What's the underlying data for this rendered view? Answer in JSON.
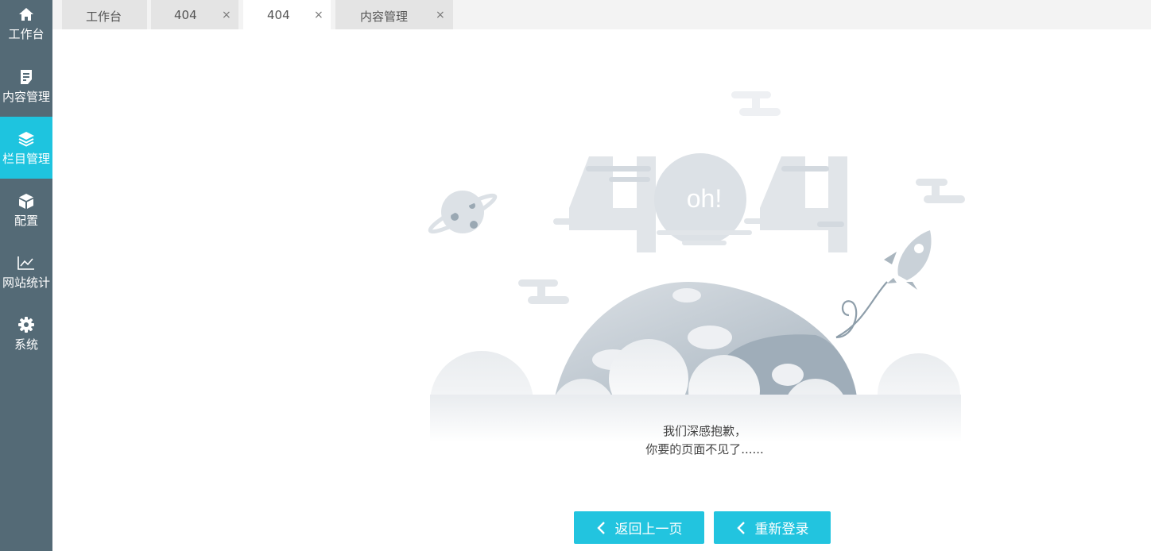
{
  "sidebar": {
    "items": [
      {
        "label": "工作台",
        "icon": "home-icon"
      },
      {
        "label": "内容管理",
        "icon": "document-edit-icon"
      },
      {
        "label": "栏目管理",
        "icon": "layers-icon",
        "active": true
      },
      {
        "label": "配置",
        "icon": "cube-icon"
      },
      {
        "label": "网站统计",
        "icon": "line-chart-icon"
      },
      {
        "label": "系统",
        "icon": "gear-icon"
      }
    ]
  },
  "tabs": [
    {
      "label": "工作台",
      "closable": false
    },
    {
      "label": "404",
      "closable": true,
      "close": "×"
    },
    {
      "label": "404",
      "closable": true,
      "active": true,
      "close": "×"
    },
    {
      "label": "内容管理",
      "closable": true,
      "close": "×"
    }
  ],
  "illustration": {
    "big_text": "404",
    "bubble_text": "oh!"
  },
  "message": {
    "line1": "我们深感抱歉，",
    "line2": "你要的页面不见了......"
  },
  "buttons": {
    "back_label": "返回上一页",
    "relogin_label": "重新登录"
  },
  "colors": {
    "sidebar_bg": "#546a76",
    "accent": "#1ec4df",
    "tab_bg": "#e4e4e4"
  }
}
